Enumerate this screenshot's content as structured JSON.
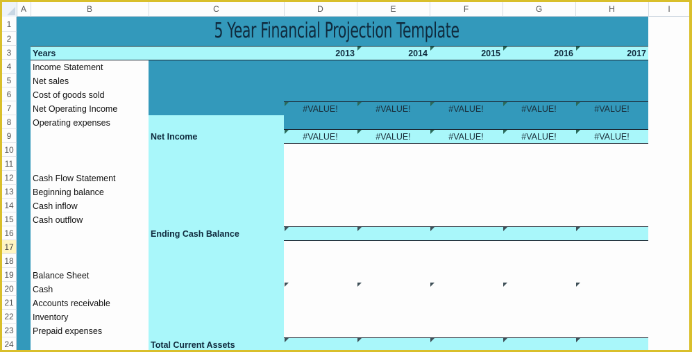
{
  "spreadsheet": {
    "columns": [
      "A",
      "B",
      "C",
      "D",
      "E",
      "F",
      "G",
      "H",
      "I"
    ],
    "rows": [
      "1",
      "2",
      "3",
      "4",
      "5",
      "6",
      "7",
      "8",
      "9",
      "10",
      "11",
      "12",
      "13",
      "14",
      "15",
      "16",
      "17",
      "18",
      "19",
      "20",
      "21",
      "22",
      "23",
      "24"
    ],
    "active_row": "17",
    "title": "5 Year Financial Projection Template",
    "years_label": "Years",
    "years": [
      "2013",
      "2014",
      "2015",
      "2016",
      "2017"
    ],
    "labels": {
      "income_statement": "Income Statement",
      "net_sales": "Net sales",
      "cogs": "Cost of goods sold",
      "net_operating_income": "Net Operating Income",
      "operating_expenses": "Operating expenses",
      "net_income": "Net Income",
      "cash_flow_statement": "Cash Flow Statement",
      "beginning_balance": "Beginning balance",
      "cash_inflow": "Cash inflow",
      "cash_outflow": "Cash outflow",
      "ending_cash_balance": "Ending Cash Balance",
      "balance_sheet": "Balance Sheet",
      "cash": "Cash",
      "accounts_receivable": "Accounts receivable",
      "inventory": "Inventory",
      "prepaid_expenses": "Prepaid expenses",
      "total_current_assets": "Total Current Assets"
    },
    "net_operating_income_values": [
      "#VALUE!",
      "#VALUE!",
      "#VALUE!",
      "#VALUE!",
      "#VALUE!"
    ],
    "net_income_values": [
      "#VALUE!",
      "#VALUE!",
      "#VALUE!",
      "#VALUE!",
      "#VALUE!"
    ]
  },
  "colors": {
    "teal": "#3399bb",
    "cyan": "#a9f7fa",
    "title_text": "#0f2a3d",
    "frame": "#d9bf2b"
  }
}
